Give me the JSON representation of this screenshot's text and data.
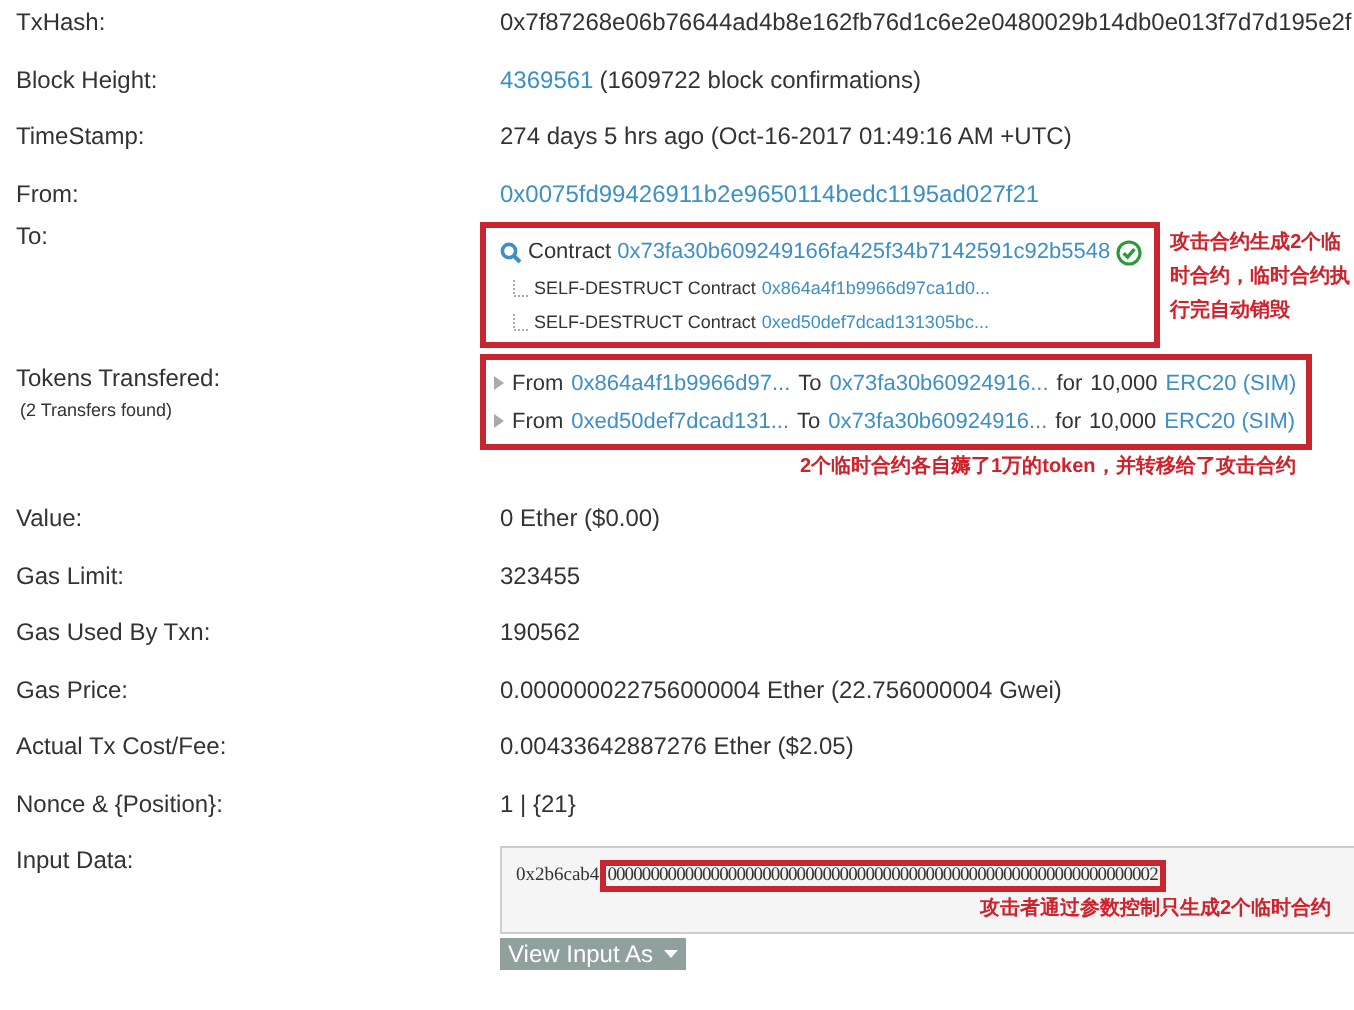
{
  "fields": [
    {
      "label": "TxHash:",
      "kind": "text",
      "value": "0x7f87268e06b76644ad4b8e162fb76d1c6e2e0480029b14db0e013f7d7d195e2f"
    },
    {
      "label": "Block Height:",
      "kind": "block",
      "link": "4369561",
      "value": "(1609722 block confirmations)"
    },
    {
      "label": "TimeStamp:",
      "kind": "text",
      "value": "274 days 5 hrs ago (Oct-16-2017 01:49:16 AM +UTC)"
    },
    {
      "label": "From:",
      "kind": "link",
      "value": "0x0075fd99426911b2e9650114bedc1195ad027f21"
    },
    {
      "label": "To:",
      "kind": "to",
      "prefix": "Contract",
      "address": "0x73fa30b609249166fa425f34b7142591c92b5548",
      "verified": true,
      "children": [
        {
          "prefix": "SELF-DESTRUCT Contract",
          "address": "0x864a4f1b9966d97ca1d0..."
        },
        {
          "prefix": "SELF-DESTRUCT Contract",
          "address": "0xed50def7dcad131305bc..."
        }
      ],
      "note": "攻击合约生成2个临时合约，临时合约执行完自动销毁"
    },
    {
      "label": "Tokens Transfered:",
      "sublabel": "(2 Transfers found)",
      "kind": "tokens",
      "transfers": [
        {
          "from_label": "From",
          "from": "0x864a4f1b9966d97...",
          "to_label": "To",
          "to": "0x73fa30b60924916...",
          "for_label": "for",
          "amount": "10,000",
          "token": "ERC20 (SIM)"
        },
        {
          "from_label": "From",
          "from": "0xed50def7dcad131...",
          "to_label": "To",
          "to": "0x73fa30b60924916...",
          "for_label": "for",
          "amount": "10,000",
          "token": "ERC20 (SIM)"
        }
      ],
      "note": "2个临时合约各自薅了1万的token，并转移给了攻击合约"
    },
    {
      "label": "Value:",
      "kind": "text",
      "value": "0 Ether ($0.00)"
    },
    {
      "label": "Gas Limit:",
      "kind": "text",
      "value": "323455"
    },
    {
      "label": "Gas Used By Txn:",
      "kind": "text",
      "value": "190562"
    },
    {
      "label": "Gas Price:",
      "kind": "text",
      "value": "0.000000022756000004 Ether (22.756000004 Gwei)"
    },
    {
      "label": "Actual Tx Cost/Fee:",
      "kind": "text",
      "value": "0.00433642887276 Ether ($2.05)"
    },
    {
      "label": "Nonce & {Position}:",
      "kind": "text",
      "value": "1 | {21}"
    },
    {
      "label": "Input Data:",
      "kind": "input",
      "method": "0x2b6cab4",
      "args": "0000000000000000000000000000000000000000000000000000000000000002",
      "note": "攻击者通过参数控制只生成2个临时合约",
      "button": "View Input As"
    }
  ]
}
